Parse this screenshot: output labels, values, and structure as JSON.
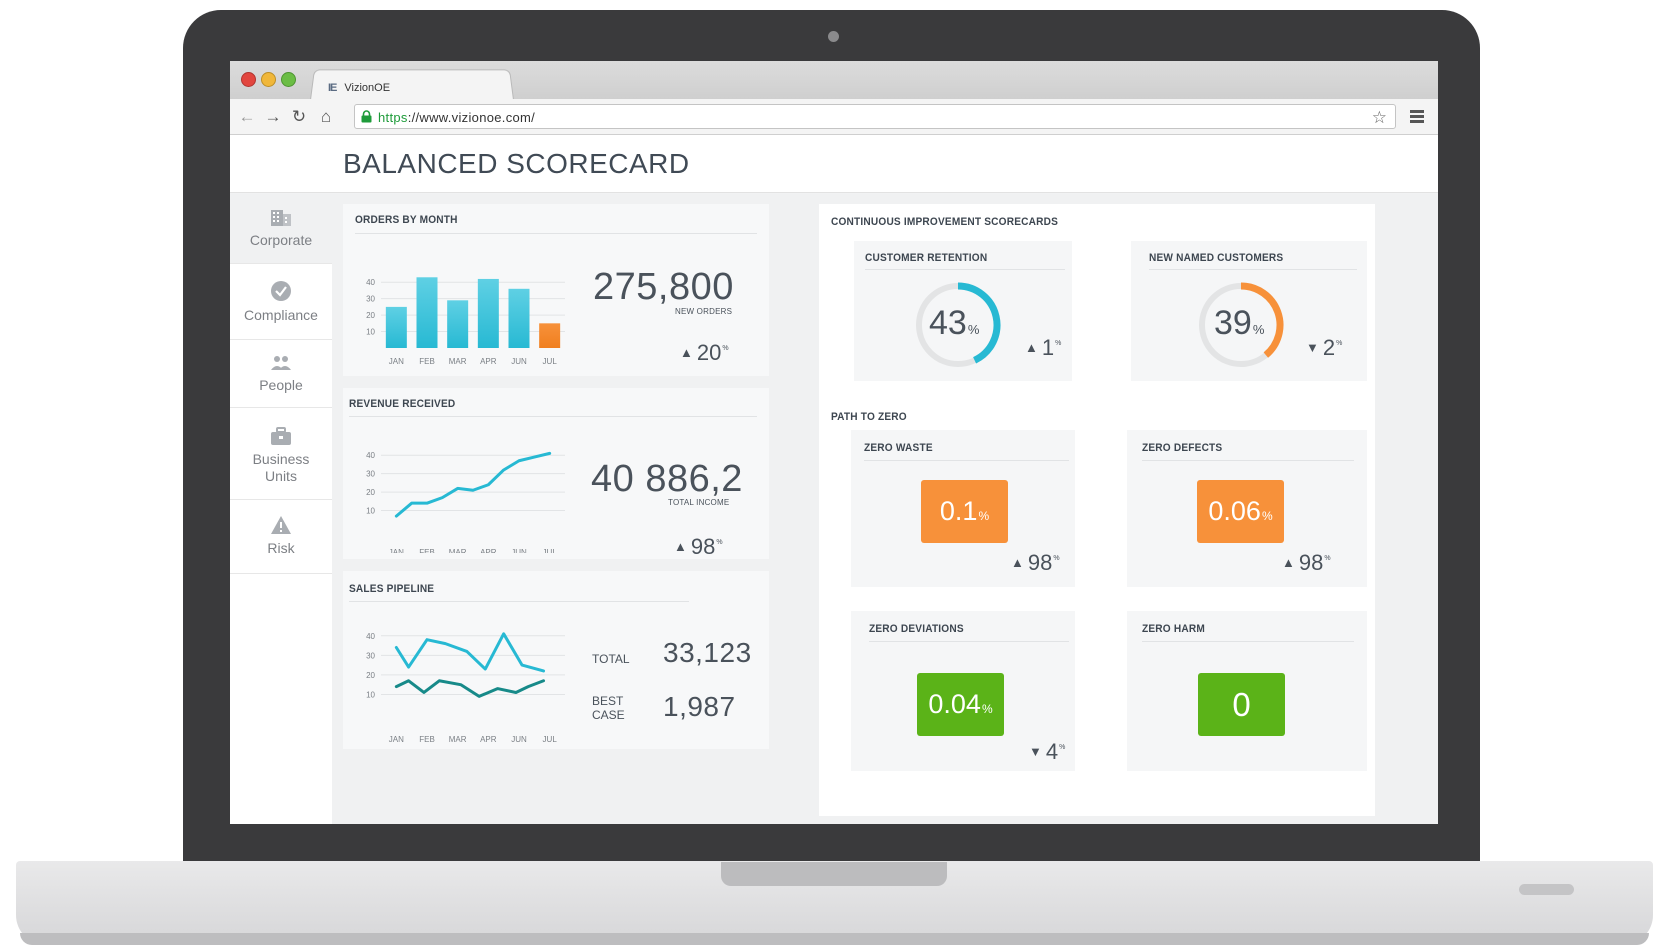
{
  "browser": {
    "tab_title": "VizionOE",
    "tab_icon": "IE",
    "url_scheme": "https",
    "url_rest": "://www.vizionoe.com/"
  },
  "page": {
    "title": "BALANCED SCORECARD"
  },
  "sidebar": {
    "items": [
      {
        "label": "Corporate",
        "icon": "building-icon"
      },
      {
        "label": "Compliance",
        "icon": "check-circle-icon"
      },
      {
        "label": "People",
        "icon": "people-icon"
      },
      {
        "label": "Business Units",
        "icon": "briefcase-icon"
      },
      {
        "label": "Risk",
        "icon": "warning-icon"
      }
    ]
  },
  "orders": {
    "title": "ORDERS BY MONTH",
    "value": "275,800",
    "sublabel": "NEW ORDERS",
    "delta": "20",
    "delta_dir": "up",
    "delta_unit": "%"
  },
  "revenue": {
    "title": "REVENUE RECEIVED",
    "value": "40 886,2",
    "sublabel": "TOTAL INCOME",
    "delta": "98",
    "delta_dir": "up",
    "delta_unit": "%"
  },
  "pipeline": {
    "title": "SALES PIPELINE",
    "total_label": "TOTAL",
    "total_value": "33,123",
    "best_label_1": "BEST",
    "best_label_2": "CASE",
    "best_value": "1,987"
  },
  "scorecards": {
    "title": "CONTINUOUS IMPROVEMENT SCORECARDS",
    "retention": {
      "title": "CUSTOMER RETENTION",
      "value": "43",
      "pct": "%",
      "delta": "1",
      "delta_dir": "up",
      "delta_unit": "%",
      "color": "#27b9d3"
    },
    "new_customers": {
      "title": "NEW NAMED CUSTOMERS",
      "value": "39",
      "pct": "%",
      "delta": "2",
      "delta_dir": "down",
      "delta_unit": "%",
      "color": "#f7913a"
    }
  },
  "path_to_zero": {
    "title": "PATH TO ZERO",
    "waste": {
      "title": "ZERO WASTE",
      "value": "0.1",
      "pct": "%",
      "delta": "98",
      "delta_dir": "up",
      "delta_unit": "%",
      "color": "#f7913a"
    },
    "defects": {
      "title": "ZERO DEFECTS",
      "value": "0.06",
      "pct": "%",
      "delta": "98",
      "delta_dir": "up",
      "delta_unit": "%",
      "color": "#f7913a"
    },
    "deviations": {
      "title": "ZERO DEVIATIONS",
      "value": "0.04",
      "pct": "%",
      "delta": "4",
      "delta_dir": "down",
      "delta_unit": "%",
      "color": "#5bb318"
    },
    "harm": {
      "title": "ZERO HARM",
      "value": "0",
      "color": "#5bb318"
    }
  },
  "chart_data": [
    {
      "type": "bar",
      "categories": [
        "JAN",
        "FEB",
        "MAR",
        "APR",
        "JUN",
        "JUL"
      ],
      "values": [
        25,
        43,
        29,
        42,
        36,
        15
      ],
      "highlight_last": true,
      "colors": [
        "#27b9d3",
        "#f7913a"
      ],
      "yticks": [
        10,
        20,
        30,
        40
      ],
      "ylim": [
        0,
        45
      ]
    },
    {
      "type": "line",
      "categories": [
        "JAN",
        "FEB",
        "MAR",
        "APR",
        "JUN",
        "JUL"
      ],
      "x": [
        0,
        0.5,
        1,
        1.5,
        2,
        2.5,
        3,
        3.5,
        4,
        4.5,
        5
      ],
      "values": [
        7,
        14,
        14,
        17,
        22,
        21,
        24,
        32,
        37,
        39,
        41
      ],
      "color": "#27b9d3",
      "yticks": [
        10,
        20,
        30,
        40
      ],
      "ylim": [
        0,
        45
      ]
    },
    {
      "type": "line",
      "categories": [
        "JAN",
        "FEB",
        "MAR",
        "APR",
        "JUN",
        "JUL"
      ],
      "series": [
        {
          "x": [
            0,
            0.4,
            1,
            1.6,
            2.3,
            2.9,
            3.5,
            4.1,
            4.8
          ],
          "values": [
            34,
            24,
            38,
            36,
            32,
            23,
            41,
            25,
            22
          ],
          "color": "#27b9d3"
        },
        {
          "x": [
            0,
            0.4,
            0.9,
            1.4,
            2.1,
            2.7,
            3.3,
            3.9,
            4.3,
            4.8
          ],
          "values": [
            14,
            17,
            11,
            17,
            15,
            9,
            13,
            11,
            14,
            17
          ],
          "color": "#178a89"
        }
      ],
      "yticks": [
        10,
        20,
        30,
        40
      ],
      "ylim": [
        0,
        45
      ]
    },
    {
      "type": "pie",
      "name": "retention-gauge",
      "values": [
        43,
        57
      ],
      "colors": [
        "#27b9d3",
        "#e3e4e5"
      ]
    },
    {
      "type": "pie",
      "name": "new-customers-gauge",
      "values": [
        39,
        61
      ],
      "colors": [
        "#f7913a",
        "#e3e4e5"
      ]
    }
  ]
}
